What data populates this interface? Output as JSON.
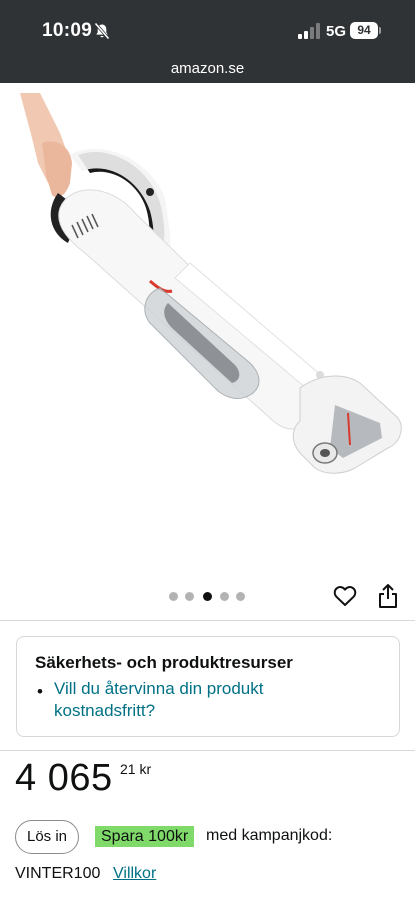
{
  "status_bar": {
    "time": "10:09",
    "network": "5G",
    "battery": "94"
  },
  "browser": {
    "url": "amazon.se"
  },
  "gallery": {
    "image_count": 5,
    "active_index": 2
  },
  "resources": {
    "title": "Säkerhets- och produktresurser",
    "bullet": "•",
    "link_text": "Vill du återvinna din produkt kostnadsfritt?"
  },
  "price": {
    "whole": "4 065",
    "fraction_currency": "21 kr"
  },
  "coupon": {
    "button_label": "Lös in",
    "save_label": "Spara 100kr",
    "text": "med kampanjkod:",
    "code": "VINTER100",
    "terms_label": "Villkor"
  },
  "colors": {
    "link": "#007185",
    "save_badge": "#7fda69",
    "topbar": "#2f3335"
  }
}
